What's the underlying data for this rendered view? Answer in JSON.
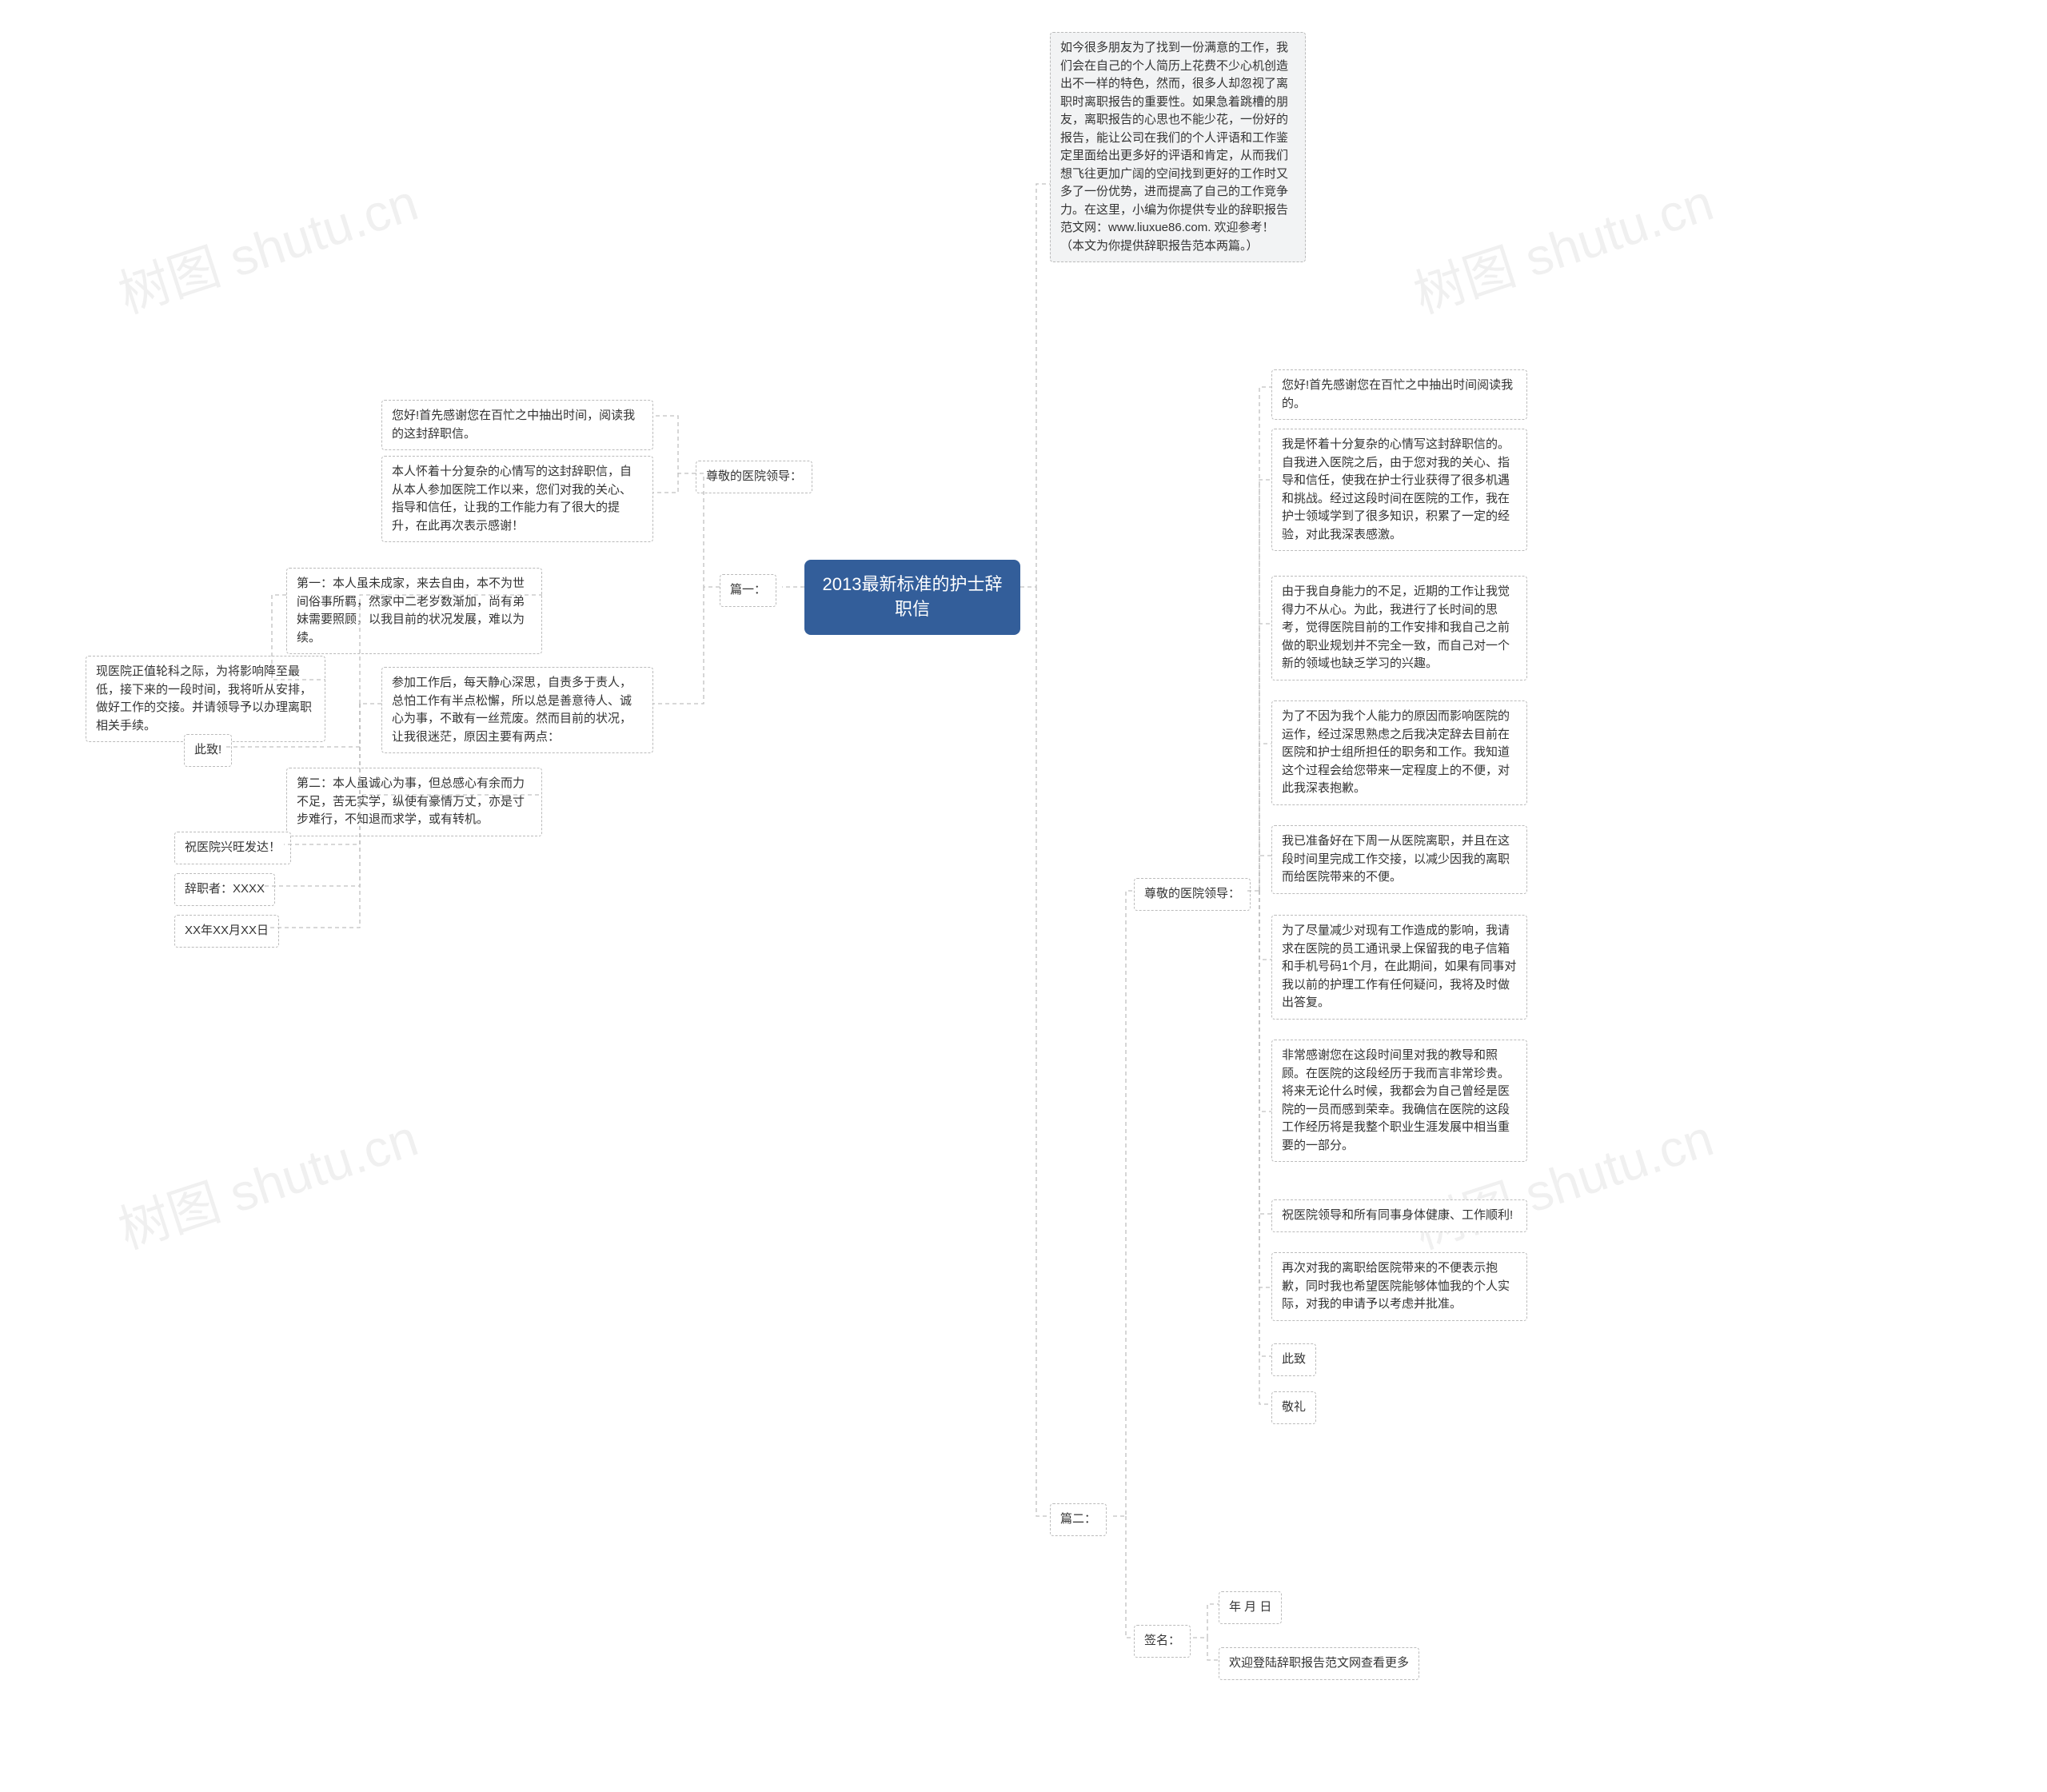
{
  "root": "2013最新标准的护士辞职信",
  "preface": "如今很多朋友为了找到一份满意的工作，我们会在自己的个人简历上花费不少心机创造出不一样的特色，然而，很多人却忽视了离职时离职报告的重要性。如果急着跳槽的朋友，离职报告的心思也不能少花，一份好的报告，能让公司在我们的个人评语和工作鉴定里面给出更多好的评语和肯定，从而我们想飞往更加广阔的空间找到更好的工作时又多了一份优势，进而提高了自己的工作竞争力。在这里，小编为你提供专业的辞职报告范文网：www.liuxue86.com. 欢迎参考！（本文为你提供辞职报告范本两篇。）",
  "p1": {
    "label": "篇一：",
    "leader": "尊敬的医院领导：",
    "a1": "您好!首先感谢您在百忙之中抽出时间，阅读我的这封辞职信。",
    "a2": "本人怀着十分复杂的心情写的这封辞职信，自从本人参加医院工作以来，您们对我的关心、指导和信任，让我的工作能力有了很大的提升，在此再次表示感谢！",
    "a3": "参加工作后，每天静心深思，自责多于责人，总怕工作有半点松懈，所以总是善意待人、诚心为事，不敢有一丝荒废。然而目前的状况，让我很迷茫，原因主要有两点：",
    "r1": "第一：本人虽未成家，来去自由，本不为世间俗事所羁，然家中二老岁数渐加，尚有弟妹需要照顾，以我目前的状况发展，难以为续。",
    "r2": "第二：本人虽诚心为事，但总感心有余而力不足，苦无实学，纵使有豪情万丈，亦是寸步难行，不知退而求学，或有转机。",
    "closing": "现医院正值轮科之际，为将影响降至最低，接下来的一段时间，我将听从安排，做好工作的交接。并请领导予以办理离职相关手续。",
    "salute1": "此致!",
    "salute2": "祝医院兴旺发达！",
    "signer": "辞职者：XXXX",
    "date": "XX年XX月XX日"
  },
  "p2": {
    "label": "篇二：",
    "leader": "尊敬的医院领导：",
    "b1": "您好!首先感谢您在百忙之中抽出时间阅读我的。",
    "b2": "我是怀着十分复杂的心情写这封辞职信的。自我进入医院之后，由于您对我的关心、指导和信任，使我在护士行业获得了很多机遇和挑战。经过这段时间在医院的工作，我在护士领域学到了很多知识，积累了一定的经验，对此我深表感激。",
    "b3": "由于我自身能力的不足，近期的工作让我觉得力不从心。为此，我进行了长时间的思考，觉得医院目前的工作安排和我自己之前做的职业规划并不完全一致，而自己对一个新的领域也缺乏学习的兴趣。",
    "b4": "为了不因为我个人能力的原因而影响医院的运作，经过深思熟虑之后我决定辞去目前在医院和护士组所担任的职务和工作。我知道这个过程会给您带来一定程度上的不便，对此我深表抱歉。",
    "b5": "我已准备好在下周一从医院离职，并且在这段时间里完成工作交接，以减少因我的离职而给医院带来的不便。",
    "b6": "为了尽量减少对现有工作造成的影响，我请求在医院的员工通讯录上保留我的电子信箱和手机号码1个月，在此期间，如果有同事对我以前的护理工作有任何疑问，我将及时做出答复。",
    "b7": "非常感谢您在这段时间里对我的教导和照顾。在医院的这段经历于我而言非常珍贵。将来无论什么时候，我都会为自己曾经是医院的一员而感到荣幸。我确信在医院的这段工作经历将是我整个职业生涯发展中相当重要的一部分。",
    "b8": "祝医院领导和所有同事身体健康、工作顺利!",
    "b9": "再次对我的离职给医院带来的不便表示抱歉，同时我也希望医院能够体恤我的个人实际，对我的申请予以考虑并批准。",
    "b10": "此致",
    "b11": "敬礼",
    "sign": "签名：",
    "date": "年 月 日",
    "more": "欢迎登陆辞职报告范文网查看更多"
  },
  "watermark": "树图 shutu.cn"
}
